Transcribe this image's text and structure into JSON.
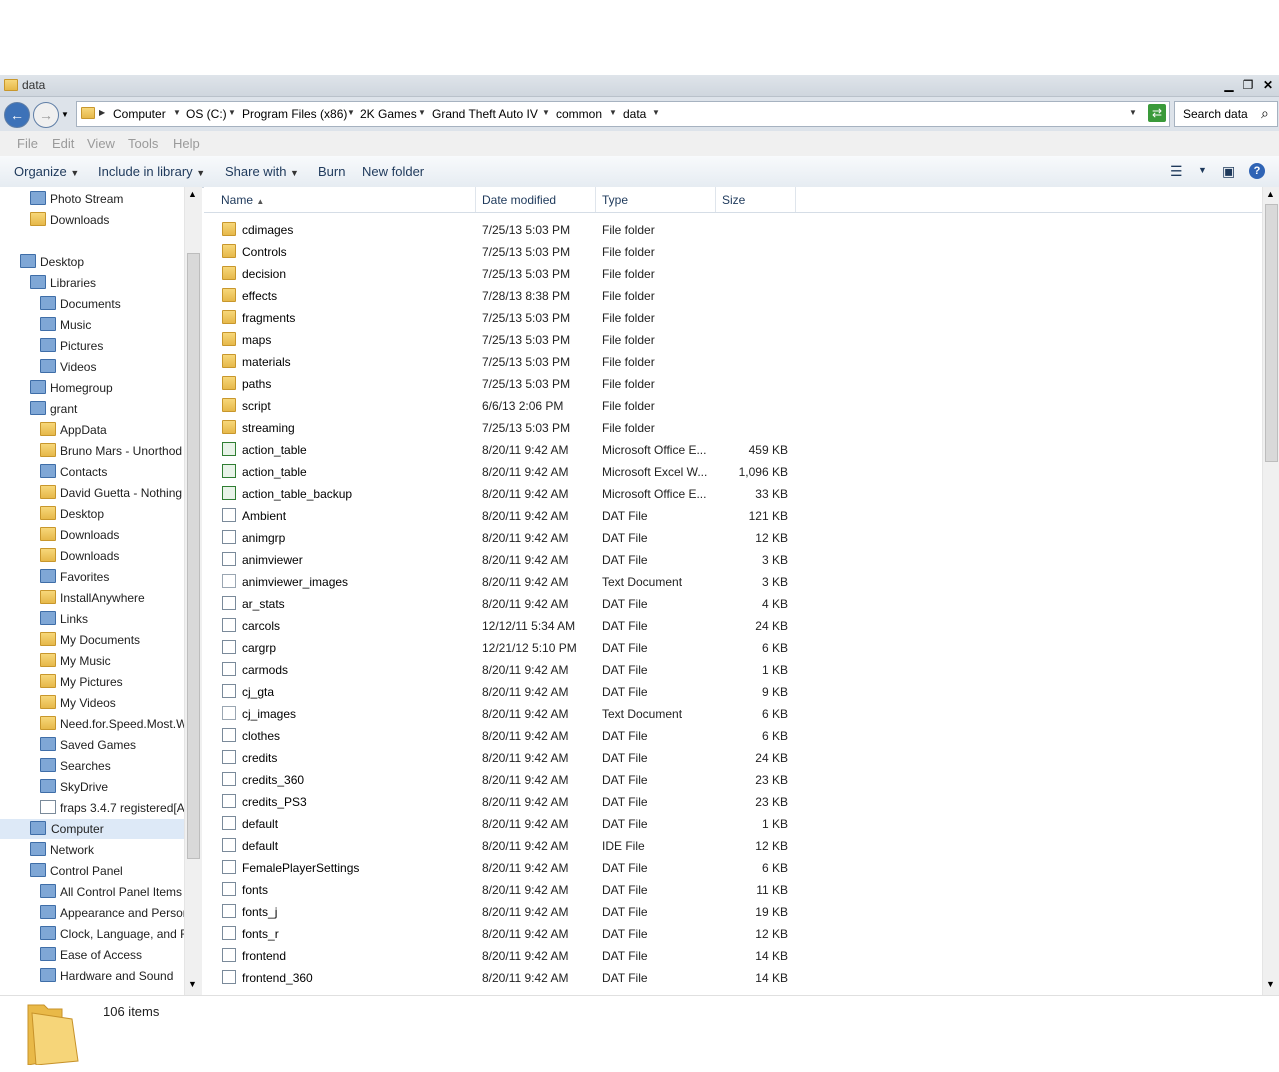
{
  "window": {
    "title": "data"
  },
  "address": {
    "crumbs": [
      "Computer",
      "OS (C:)",
      "Program Files (x86)",
      "2K Games",
      "Grand Theft Auto IV",
      "common",
      "data"
    ],
    "search_placeholder": "Search data"
  },
  "menu": [
    "File",
    "Edit",
    "View",
    "Tools",
    "Help"
  ],
  "commands": {
    "organize": "Organize",
    "include": "Include in library",
    "share": "Share with",
    "burn": "Burn",
    "new_folder": "New folder"
  },
  "nav": [
    {
      "label": "Photo Stream",
      "icon": "photo-stream-icon"
    },
    {
      "label": "Downloads",
      "icon": "folder-icon"
    },
    {
      "label": "",
      "icon": ""
    },
    {
      "label": "Desktop",
      "icon": "desktop-icon"
    },
    {
      "label": "Libraries",
      "icon": "libraries-icon"
    },
    {
      "label": "Documents",
      "icon": "documents-icon"
    },
    {
      "label": "Music",
      "icon": "music-icon"
    },
    {
      "label": "Pictures",
      "icon": "pictures-icon"
    },
    {
      "label": "Videos",
      "icon": "videos-icon"
    },
    {
      "label": "Homegroup",
      "icon": "homegroup-icon"
    },
    {
      "label": "grant",
      "icon": "user-icon"
    },
    {
      "label": "AppData",
      "icon": "folder-icon"
    },
    {
      "label": "Bruno Mars - Unorthod",
      "icon": "folder-icon"
    },
    {
      "label": "Contacts",
      "icon": "contacts-icon"
    },
    {
      "label": "David Guetta - Nothing",
      "icon": "folder-icon"
    },
    {
      "label": "Desktop",
      "icon": "folder-icon"
    },
    {
      "label": "Downloads",
      "icon": "folder-icon"
    },
    {
      "label": "Downloads",
      "icon": "folder-icon"
    },
    {
      "label": "Favorites",
      "icon": "favorites-icon"
    },
    {
      "label": "InstallAnywhere",
      "icon": "folder-icon"
    },
    {
      "label": "Links",
      "icon": "links-icon"
    },
    {
      "label": "My Documents",
      "icon": "folder-icon"
    },
    {
      "label": "My Music",
      "icon": "folder-icon"
    },
    {
      "label": "My Pictures",
      "icon": "folder-icon"
    },
    {
      "label": "My Videos",
      "icon": "folder-icon"
    },
    {
      "label": "Need.for.Speed.Most.W",
      "icon": "folder-icon"
    },
    {
      "label": "Saved Games",
      "icon": "saved-games-icon"
    },
    {
      "label": "Searches",
      "icon": "searches-icon"
    },
    {
      "label": "SkyDrive",
      "icon": "skydrive-icon"
    },
    {
      "label": "fraps 3.4.7 registered[A",
      "icon": "file-icon"
    },
    {
      "label": "Computer",
      "icon": "computer-icon"
    },
    {
      "label": "Network",
      "icon": "network-icon"
    },
    {
      "label": "Control Panel",
      "icon": "control-panel-icon"
    },
    {
      "label": "All Control Panel Items",
      "icon": "control-panel-icon"
    },
    {
      "label": "Appearance and Persor",
      "icon": "appearance-icon"
    },
    {
      "label": "Clock, Language, and R",
      "icon": "clock-icon"
    },
    {
      "label": "Ease of Access",
      "icon": "ease-of-access-icon"
    },
    {
      "label": "Hardware and Sound",
      "icon": "hardware-icon"
    }
  ],
  "columns": {
    "name": "Name",
    "date": "Date modified",
    "type": "Type",
    "size": "Size"
  },
  "files": [
    {
      "name": "cdimages",
      "date": "7/25/13 5:03 PM",
      "type": "File folder",
      "size": "",
      "kind": "folder"
    },
    {
      "name": "Controls",
      "date": "7/25/13 5:03 PM",
      "type": "File folder",
      "size": "",
      "kind": "folder"
    },
    {
      "name": "decision",
      "date": "7/25/13 5:03 PM",
      "type": "File folder",
      "size": "",
      "kind": "folder"
    },
    {
      "name": "effects",
      "date": "7/28/13 8:38 PM",
      "type": "File folder",
      "size": "",
      "kind": "folder"
    },
    {
      "name": "fragments",
      "date": "7/25/13 5:03 PM",
      "type": "File folder",
      "size": "",
      "kind": "folder"
    },
    {
      "name": "maps",
      "date": "7/25/13 5:03 PM",
      "type": "File folder",
      "size": "",
      "kind": "folder"
    },
    {
      "name": "materials",
      "date": "7/25/13 5:03 PM",
      "type": "File folder",
      "size": "",
      "kind": "folder"
    },
    {
      "name": "paths",
      "date": "7/25/13 5:03 PM",
      "type": "File folder",
      "size": "",
      "kind": "folder"
    },
    {
      "name": "script",
      "date": "6/6/13 2:06 PM",
      "type": "File folder",
      "size": "",
      "kind": "folder"
    },
    {
      "name": "streaming",
      "date": "7/25/13 5:03 PM",
      "type": "File folder",
      "size": "",
      "kind": "folder"
    },
    {
      "name": "action_table",
      "date": "8/20/11 9:42 AM",
      "type": "Microsoft Office E...",
      "size": "459 KB",
      "kind": "xls"
    },
    {
      "name": "action_table",
      "date": "8/20/11 9:42 AM",
      "type": "Microsoft Excel W...",
      "size": "1,096 KB",
      "kind": "xls"
    },
    {
      "name": "action_table_backup",
      "date": "8/20/11 9:42 AM",
      "type": "Microsoft Office E...",
      "size": "33 KB",
      "kind": "xls"
    },
    {
      "name": "Ambient",
      "date": "8/20/11 9:42 AM",
      "type": "DAT File",
      "size": "121 KB",
      "kind": "file"
    },
    {
      "name": "animgrp",
      "date": "8/20/11 9:42 AM",
      "type": "DAT File",
      "size": "12 KB",
      "kind": "file"
    },
    {
      "name": "animviewer",
      "date": "8/20/11 9:42 AM",
      "type": "DAT File",
      "size": "3 KB",
      "kind": "file"
    },
    {
      "name": "animviewer_images",
      "date": "8/20/11 9:42 AM",
      "type": "Text Document",
      "size": "3 KB",
      "kind": "txt"
    },
    {
      "name": "ar_stats",
      "date": "8/20/11 9:42 AM",
      "type": "DAT File",
      "size": "4 KB",
      "kind": "file"
    },
    {
      "name": "carcols",
      "date": "12/12/11 5:34 AM",
      "type": "DAT File",
      "size": "24 KB",
      "kind": "file"
    },
    {
      "name": "cargrp",
      "date": "12/21/12 5:10 PM",
      "type": "DAT File",
      "size": "6 KB",
      "kind": "file"
    },
    {
      "name": "carmods",
      "date": "8/20/11 9:42 AM",
      "type": "DAT File",
      "size": "1 KB",
      "kind": "file"
    },
    {
      "name": "cj_gta",
      "date": "8/20/11 9:42 AM",
      "type": "DAT File",
      "size": "9 KB",
      "kind": "file"
    },
    {
      "name": "cj_images",
      "date": "8/20/11 9:42 AM",
      "type": "Text Document",
      "size": "6 KB",
      "kind": "txt"
    },
    {
      "name": "clothes",
      "date": "8/20/11 9:42 AM",
      "type": "DAT File",
      "size": "6 KB",
      "kind": "file"
    },
    {
      "name": "credits",
      "date": "8/20/11 9:42 AM",
      "type": "DAT File",
      "size": "24 KB",
      "kind": "file"
    },
    {
      "name": "credits_360",
      "date": "8/20/11 9:42 AM",
      "type": "DAT File",
      "size": "23 KB",
      "kind": "file"
    },
    {
      "name": "credits_PS3",
      "date": "8/20/11 9:42 AM",
      "type": "DAT File",
      "size": "23 KB",
      "kind": "file"
    },
    {
      "name": "default",
      "date": "8/20/11 9:42 AM",
      "type": "DAT File",
      "size": "1 KB",
      "kind": "file"
    },
    {
      "name": "default",
      "date": "8/20/11 9:42 AM",
      "type": "IDE File",
      "size": "12 KB",
      "kind": "file"
    },
    {
      "name": "FemalePlayerSettings",
      "date": "8/20/11 9:42 AM",
      "type": "DAT File",
      "size": "6 KB",
      "kind": "file"
    },
    {
      "name": "fonts",
      "date": "8/20/11 9:42 AM",
      "type": "DAT File",
      "size": "11 KB",
      "kind": "file"
    },
    {
      "name": "fonts_j",
      "date": "8/20/11 9:42 AM",
      "type": "DAT File",
      "size": "19 KB",
      "kind": "file"
    },
    {
      "name": "fonts_r",
      "date": "8/20/11 9:42 AM",
      "type": "DAT File",
      "size": "12 KB",
      "kind": "file"
    },
    {
      "name": "frontend",
      "date": "8/20/11 9:42 AM",
      "type": "DAT File",
      "size": "14 KB",
      "kind": "file"
    },
    {
      "name": "frontend_360",
      "date": "8/20/11 9:42 AM",
      "type": "DAT File",
      "size": "14 KB",
      "kind": "file"
    }
  ],
  "status": {
    "item_count": "106 items"
  }
}
